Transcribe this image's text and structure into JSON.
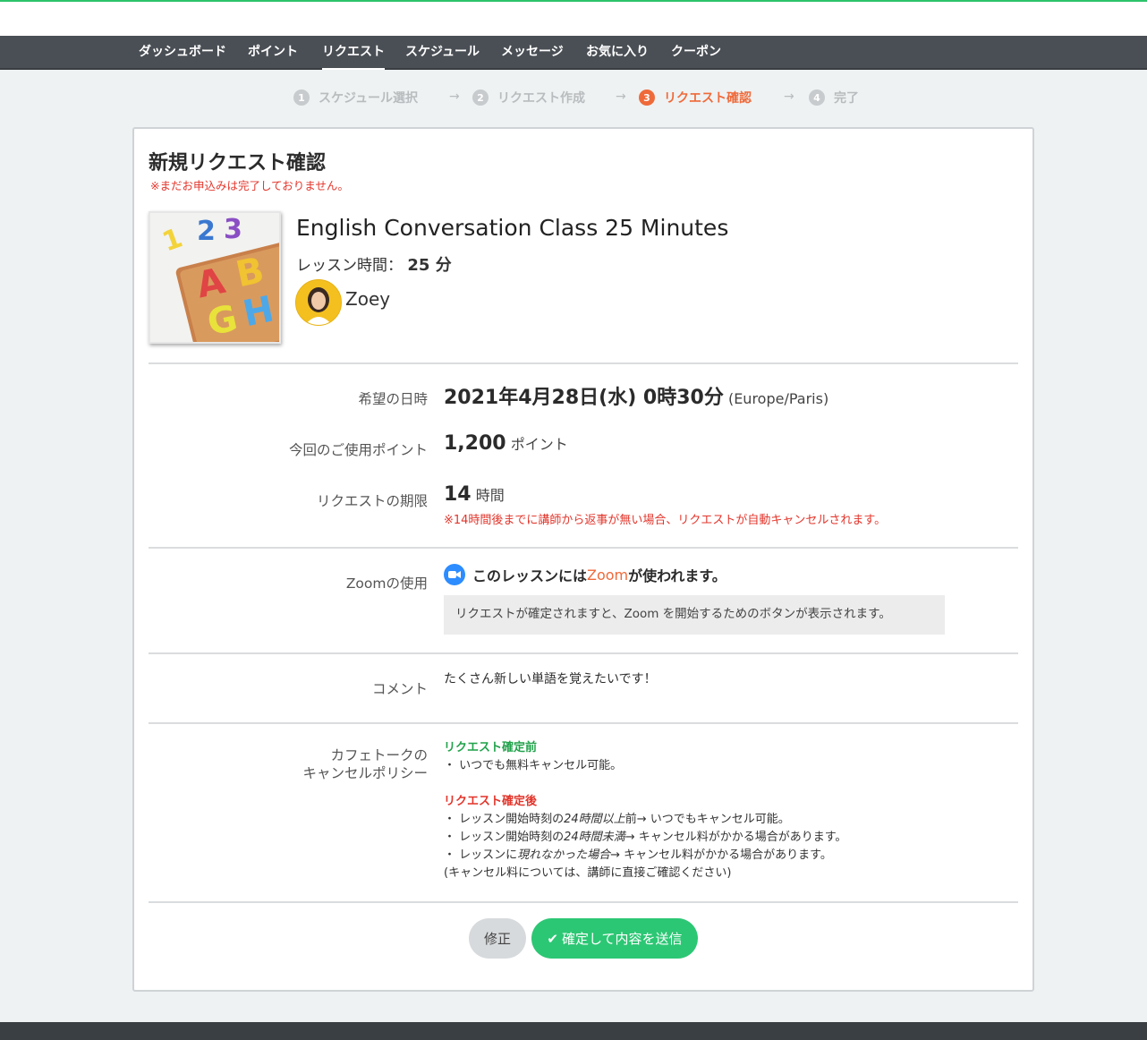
{
  "nav": {
    "items": [
      "ダッシュボード",
      "ポイント",
      "リクエスト",
      "スケジュール",
      "メッセージ",
      "お気に入り",
      "クーポン"
    ],
    "active": "リクエスト"
  },
  "steps": [
    {
      "num": "1",
      "label": "スケジュール選択"
    },
    {
      "num": "2",
      "label": "リクエスト作成"
    },
    {
      "num": "3",
      "label": "リクエスト確認"
    },
    {
      "num": "4",
      "label": "完了"
    }
  ],
  "step_arrow": "→",
  "current_step": 3,
  "card": {
    "title": "新規リクエスト確認",
    "warning": "※まだお申込みは完了しておりません。",
    "course_title": "English Conversation Class 25 Minutes",
    "duration_label": "レッスン時間：",
    "duration_value": "25 分",
    "teacher": "Zoey",
    "thumbnail_letters": [
      "1",
      "2",
      "3",
      "A",
      "B",
      "G",
      "H"
    ]
  },
  "rows": {
    "datetime": {
      "label": "希望の日時",
      "value": "2021年4月28日(水) 0時30分",
      "tz": "(Europe/Paris)"
    },
    "points": {
      "label": "今回のご使用ポイント",
      "value": "1,200",
      "unit": "ポイント"
    },
    "deadline": {
      "label": "リクエストの期限",
      "value": "14",
      "unit": "時間",
      "note": "※14時間後までに講師から返事が無い場合、リクエストが自動キャンセルされます。"
    },
    "zoom": {
      "label": "Zoomの使用",
      "head_pre": "このレッスンには",
      "brand": "Zoom",
      "head_post": "が使われます。",
      "note": "リクエストが確定されますと、Zoom を開始するためのボタンが表示されます。"
    },
    "comment": {
      "label": "コメント",
      "value": "たくさん新しい単語を覚えたいです！"
    },
    "policy": {
      "label_line1": "カフェトークの",
      "label_line2": "キャンセルポリシー",
      "before_title": "リクエスト確定前",
      "before_1": "・ いつでも無料キャンセル可能。",
      "after_title": "リクエスト確定後",
      "after_1a": "・ レッスン開始時刻の",
      "after_1b": "24時間以上",
      "after_1c": "前→ いつでもキャンセル可能。",
      "after_2a": "・ レッスン開始時刻の",
      "after_2b": "24時間未満",
      "after_2c": "→ キャンセル料がかかる場合があります。",
      "after_3a": "・ レッスンに",
      "after_3b": "現れなかった場合",
      "after_3c": "→ キャンセル料がかかる場合があります。",
      "note": "(キャンセル料については、講師に直接ご確認ください)"
    }
  },
  "buttons": {
    "edit": "修正",
    "submit_icon": "✔",
    "submit": "確定して内容を送信"
  },
  "colors": {
    "accent_green": "#2cc774",
    "accent_orange": "#ef6a3a",
    "warning_red": "#e2352b",
    "zoom_blue": "#2d8cff",
    "nav_bg": "#4a4f55"
  }
}
